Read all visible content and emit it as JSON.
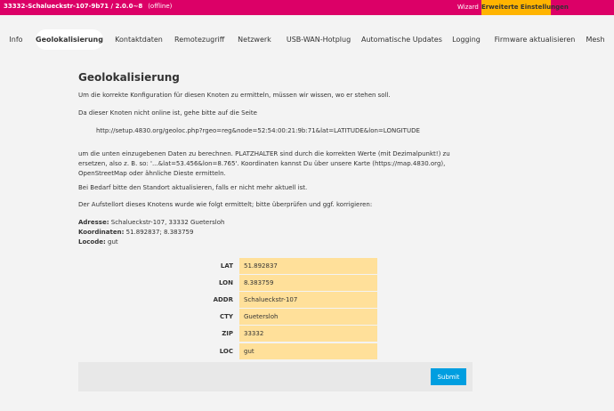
{
  "topbar": {
    "title": "33332-Schalueckstr-107-9b71 / 2.0.0~8",
    "status": "(offline)",
    "wizard": "Wizard",
    "advanced": "Erweiterte Einstellungen"
  },
  "nav": {
    "tabs": [
      {
        "label": "Info"
      },
      {
        "label": "Geolokalisierung",
        "active": true
      },
      {
        "label": "Kontaktdaten"
      },
      {
        "label": "Remotezugriff"
      },
      {
        "label": "Netzwerk"
      },
      {
        "label": "USB-WAN-Hotplug"
      },
      {
        "label": "Automatische Updates"
      },
      {
        "label": "Logging"
      },
      {
        "label": "Firmware aktualisieren"
      },
      {
        "label": "Mesh"
      }
    ]
  },
  "main": {
    "heading": "Geolokalisierung",
    "p1": "Um die korrekte Konfiguration für diesen Knoten zu ermitteln, müssen wir wissen, wo er stehen soll.",
    "p2": "Da dieser Knoten nicht online ist, gehe bitte auf die Seite",
    "url": "http://setup.4830.org/geoloc.php?rgeo=reg&node=52:54:00:21:9b:71&lat=LATITUDE&lon=LONGITUDE",
    "p3": "um die unten einzugebenen Daten zu berechnen. PLATZHALTER sind durch die korrekten Werte (mit Dezimalpunkt!) zu ersetzen, also z. B. so: '...&lat=53.456&lon=8.765'. Koordinaten kannst Du über unsere Karte (https://map.4830.org), OpenStreetMap oder ähnliche Dieste ermitteln.",
    "p4": "Bei Bedarf bitte den Standort aktualisieren, falls er nicht mehr aktuell ist.",
    "p5": "Der Aufstellort dieses Knotens wurde wie folgt ermittelt; bitte überprüfen und ggf. korrigieren:",
    "address_label": "Adresse:",
    "address_value": "Schalueckstr-107, 33332 Guetersloh",
    "coords_label": "Koordinaten:",
    "coords_value": "51.892837; 8.383759",
    "locode_label": "Locode:",
    "locode_value": "gut"
  },
  "form": {
    "fields": [
      {
        "label": "LAT",
        "value": "51.892837"
      },
      {
        "label": "LON",
        "value": "8.383759"
      },
      {
        "label": "ADDR",
        "value": "Schalueckstr-107"
      },
      {
        "label": "CTY",
        "value": "Guetersloh"
      },
      {
        "label": "ZIP",
        "value": "33332"
      },
      {
        "label": "LOC",
        "value": "gut"
      }
    ],
    "submit": "Submit"
  },
  "colors": {
    "topbar": "#dc0067",
    "advanced": "#ffb400",
    "input_bg": "#ffe09a",
    "submit": "#009ee0"
  }
}
